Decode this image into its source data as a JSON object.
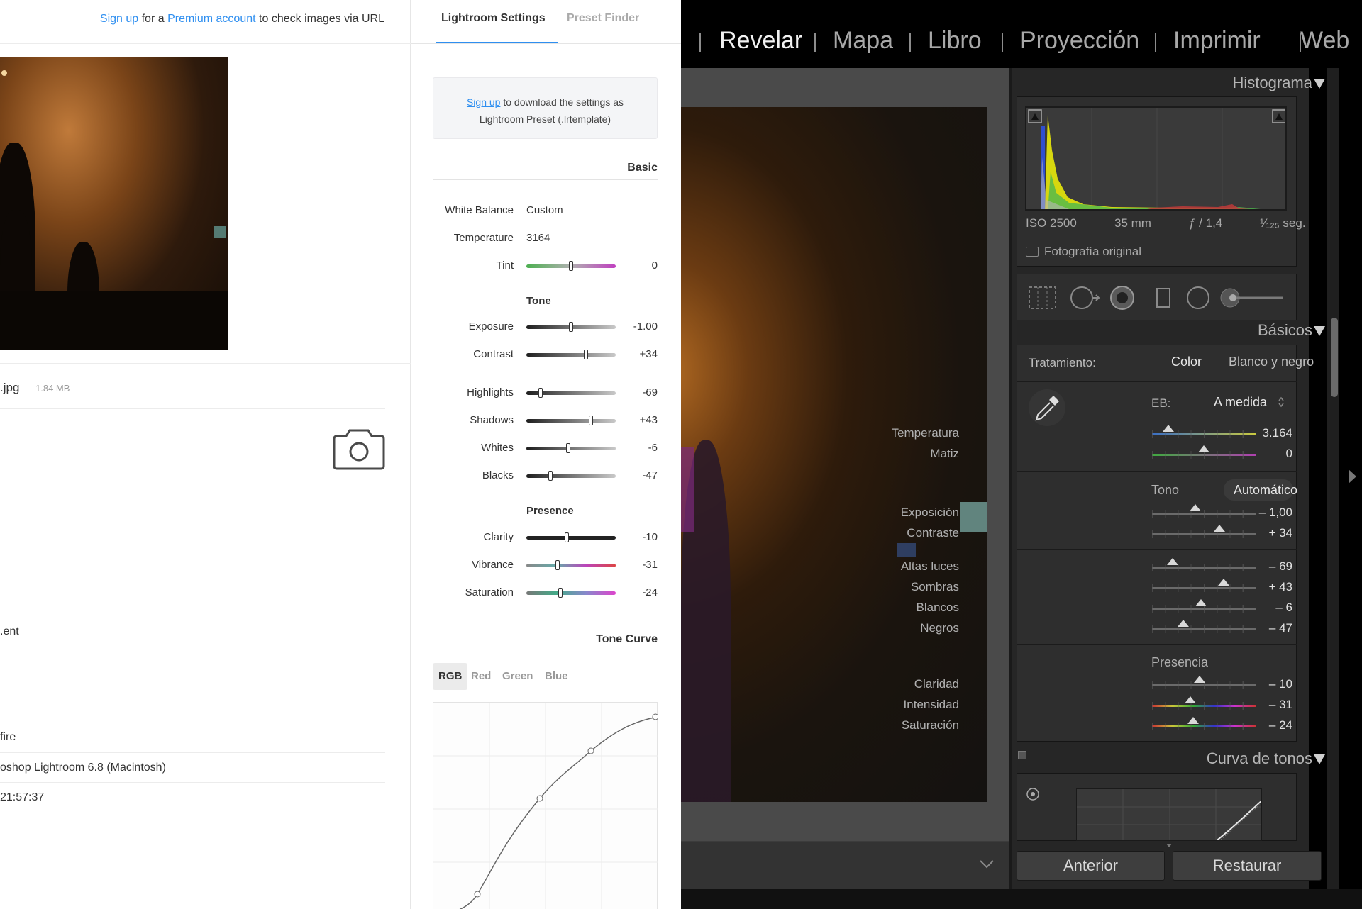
{
  "web": {
    "top_note": {
      "signup": "Sign up",
      "for_a": "for a",
      "premium": "Premium account",
      "rest": "to check images via URL"
    },
    "file": {
      "name": ".jpg",
      "size": "1.84 MB"
    },
    "meta": [
      ".ent",
      "fire",
      "oshop Lightroom 6.8 (Macintosh)",
      "21:57:37"
    ],
    "tabs": {
      "active": "Lightroom Settings",
      "inactive": "Preset Finder"
    },
    "signup_box": {
      "link": "Sign up",
      "line1": "to download the settings as",
      "line2": "Lightroom Preset (.lrtemplate)"
    },
    "sections": {
      "basic": "Basic",
      "tone": "Tone",
      "presence": "Presence",
      "tone_curve": "Tone Curve"
    },
    "white_balance": {
      "label": "White Balance",
      "value": "Custom"
    },
    "temperature": {
      "label": "Temperature",
      "value": "3164"
    },
    "tint": {
      "label": "Tint",
      "value": "0",
      "level": 0.5
    },
    "tone_sliders": [
      {
        "label": "Exposure",
        "value": "-1.00",
        "level": 0.5
      },
      {
        "label": "Contrast",
        "value": "+34",
        "level": 0.67
      },
      {
        "label": "Highlights",
        "value": "-69",
        "level": 0.16
      },
      {
        "label": "Shadows",
        "value": "+43",
        "level": 0.72
      },
      {
        "label": "Whites",
        "value": "-6",
        "level": 0.47
      },
      {
        "label": "Blacks",
        "value": "-47",
        "level": 0.27
      }
    ],
    "presence_sliders": [
      {
        "label": "Clarity",
        "value": "-10",
        "level": 0.45
      },
      {
        "label": "Vibrance",
        "value": "-31",
        "level": 0.35
      },
      {
        "label": "Saturation",
        "value": "-24",
        "level": 0.38
      }
    ],
    "curve_tabs": [
      "RGB",
      "Red",
      "Green",
      "Blue"
    ]
  },
  "lightroom": {
    "modules": [
      "Revelar",
      "Mapa",
      "Libro",
      "Proyección",
      "Imprimir",
      "Web"
    ],
    "active_module": "Revelar",
    "histogram": {
      "title": "Histograma",
      "iso": "ISO 2500",
      "focal": "35 mm",
      "aperture": "ƒ / 1,4",
      "shutter": "¹⁄₁₂₅ seg.",
      "original": "Fotografía original"
    },
    "basic": {
      "title": "Básicos",
      "treatment_label": "Tratamiento:",
      "color": "Color",
      "bw": "Blanco y negro",
      "wb_label": "EB:",
      "wb_value": "A medida",
      "temp": {
        "label": "Temperatura",
        "value": "3.164",
        "level": 0.16
      },
      "tint": {
        "label": "Matiz",
        "value": "0",
        "level": 0.5
      },
      "tone_label": "Tono",
      "auto": "Automático",
      "tone": [
        {
          "label": "Exposición",
          "value": "– 1,00",
          "level": 0.42
        },
        {
          "label": "Contraste",
          "value": "+ 34",
          "level": 0.65
        }
      ],
      "tone2": [
        {
          "label": "Altas luces",
          "value": "– 69",
          "level": 0.2
        },
        {
          "label": "Sombras",
          "value": "+ 43",
          "level": 0.69
        },
        {
          "label": "Blancos",
          "value": "– 6",
          "level": 0.47
        },
        {
          "label": "Negros",
          "value": "– 47",
          "level": 0.3
        }
      ],
      "presence_label": "Presencia",
      "presence": [
        {
          "label": "Claridad",
          "value": "– 10",
          "level": 0.46
        },
        {
          "label": "Intensidad",
          "value": "– 31",
          "level": 0.37
        },
        {
          "label": "Saturación",
          "value": "– 24",
          "level": 0.4
        }
      ]
    },
    "tone_curve": {
      "title": "Curva de tonos"
    },
    "buttons": {
      "previous": "Anterior",
      "reset": "Restaurar"
    },
    "colors": {
      "panel": "#262626",
      "subpanel": "#2e2e2e",
      "accent_link": "#2f8ff0"
    }
  }
}
